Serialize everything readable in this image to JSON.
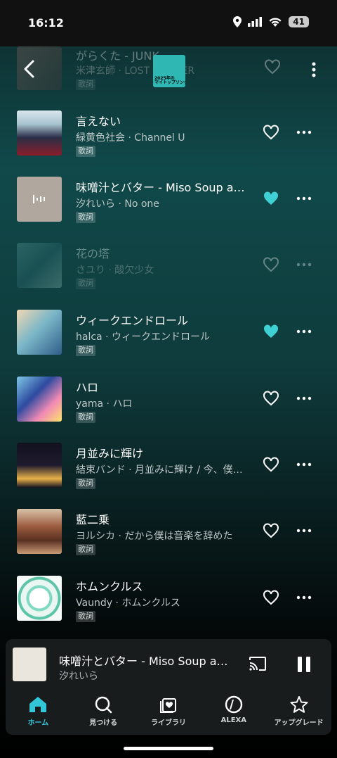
{
  "status": {
    "time": "16:12",
    "battery": "41"
  },
  "header": {
    "faded_title": "がらくた - JUNK",
    "faded_subtitle": "米津玄師 · LOST CORNER",
    "faded_badge": "歌詞",
    "album_text": "2025年の\nマイトップソング"
  },
  "tracks": [
    {
      "title": "言えない",
      "subtitle": "緑黄色社会 · Channel U",
      "badge": "歌詞",
      "liked": false,
      "dim": false
    },
    {
      "title": "味噌汁とバター - Miso Soup and Butter",
      "subtitle": "汐れいら · No one",
      "badge": "歌詞",
      "liked": true,
      "dim": false
    },
    {
      "title": "花の塔",
      "subtitle": "さユり · 酸欠少女",
      "badge": "歌詞",
      "liked": false,
      "dim": true
    },
    {
      "title": "ウィークエンドロール",
      "subtitle": "halca · ウィークエンドロール",
      "badge": "歌詞",
      "liked": true,
      "dim": false
    },
    {
      "title": "ハロ",
      "subtitle": "yama · ハロ",
      "badge": "歌詞",
      "liked": false,
      "dim": false
    },
    {
      "title": "月並みに輝け",
      "subtitle": "結束バンド · 月並みに輝け / 今、僕、アンダーグラウンドから",
      "badge": "歌詞",
      "liked": false,
      "dim": false
    },
    {
      "title": "藍二乗",
      "subtitle": "ヨルシカ · だから僕は音楽を辞めた",
      "badge": "歌詞",
      "liked": false,
      "dim": false
    },
    {
      "title": "ホムンクルス",
      "subtitle": "Vaundy · ホムンクルス",
      "badge": "歌詞",
      "liked": false,
      "dim": false
    }
  ],
  "mini_player": {
    "title": "味噌汁とバター - Miso Soup and Butter",
    "artist": "汐れいら"
  },
  "nav": [
    {
      "label": "ホーム",
      "icon": "home-icon",
      "active": true
    },
    {
      "label": "見つける",
      "icon": "search-icon",
      "active": false
    },
    {
      "label": "ライブラリ",
      "icon": "library-icon",
      "active": false
    },
    {
      "label": "ALEXA",
      "icon": "alexa-icon",
      "active": false
    },
    {
      "label": "アップグレード",
      "icon": "star-icon",
      "active": false
    }
  ],
  "colors": {
    "accent": "#33c6d6",
    "liked": "#3fd0d4"
  }
}
